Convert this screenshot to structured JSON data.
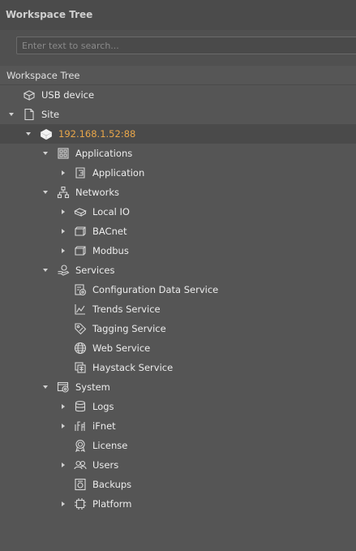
{
  "panel": {
    "title": "Workspace Tree"
  },
  "search": {
    "placeholder": "Enter text to search..."
  },
  "tree_header": "Workspace Tree",
  "tree": {
    "usb": "USB device",
    "site": "Site",
    "device_ip": "192.168.1.52:88",
    "applications": "Applications",
    "application": "Application",
    "networks": "Networks",
    "local_io": "Local IO",
    "bacnet": "BACnet",
    "modbus": "Modbus",
    "services": "Services",
    "config_data_service": "Configuration Data Service",
    "trends_service": "Trends Service",
    "tagging_service": "Tagging Service",
    "web_service": "Web Service",
    "haystack_service": "Haystack Service",
    "system": "System",
    "logs": "Logs",
    "ifnet": "iFnet",
    "license": "License",
    "users": "Users",
    "backups": "Backups",
    "platform": "Platform"
  },
  "colors": {
    "background": "#555555",
    "selected_row": "#4a4a4a",
    "ip_text": "#e8a64a",
    "text": "#ececec"
  }
}
